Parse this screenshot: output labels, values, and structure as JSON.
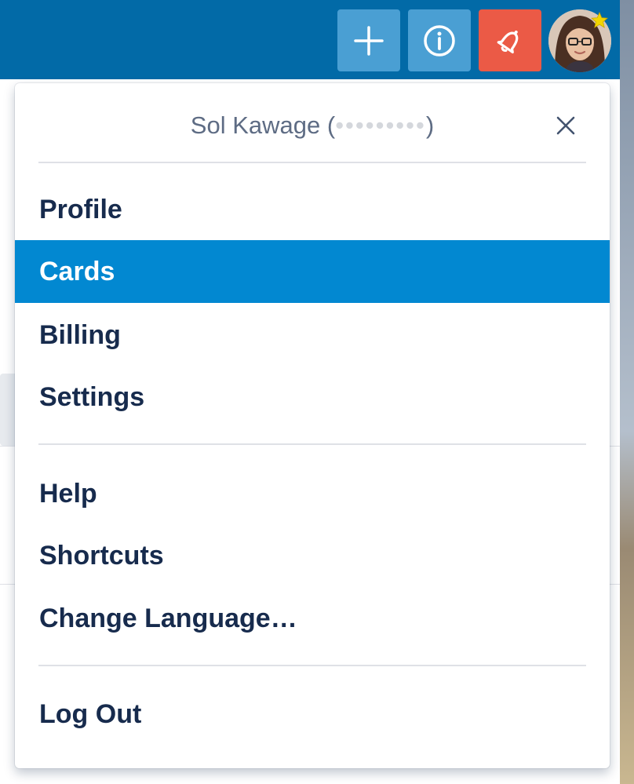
{
  "header": {
    "add_icon": "plus-icon",
    "info_icon": "info-icon",
    "notification_icon": "bell-icon",
    "colors": {
      "bar": "#026aa7",
      "button": "#4a9fd3",
      "notification": "#eb5a46"
    }
  },
  "menu": {
    "title_name": "Sol Kawage",
    "title_open": "(",
    "title_close": ")",
    "close_icon": "close-icon",
    "items": [
      {
        "label": "Profile"
      },
      {
        "label": "Cards",
        "active": true
      },
      {
        "label": "Billing"
      },
      {
        "label": "Settings"
      },
      {
        "label": "Help"
      },
      {
        "label": "Shortcuts"
      },
      {
        "label": "Change Language…"
      },
      {
        "label": "Log Out"
      }
    ],
    "colors": {
      "active_bg": "#0288d1",
      "text": "#172b4d"
    }
  }
}
